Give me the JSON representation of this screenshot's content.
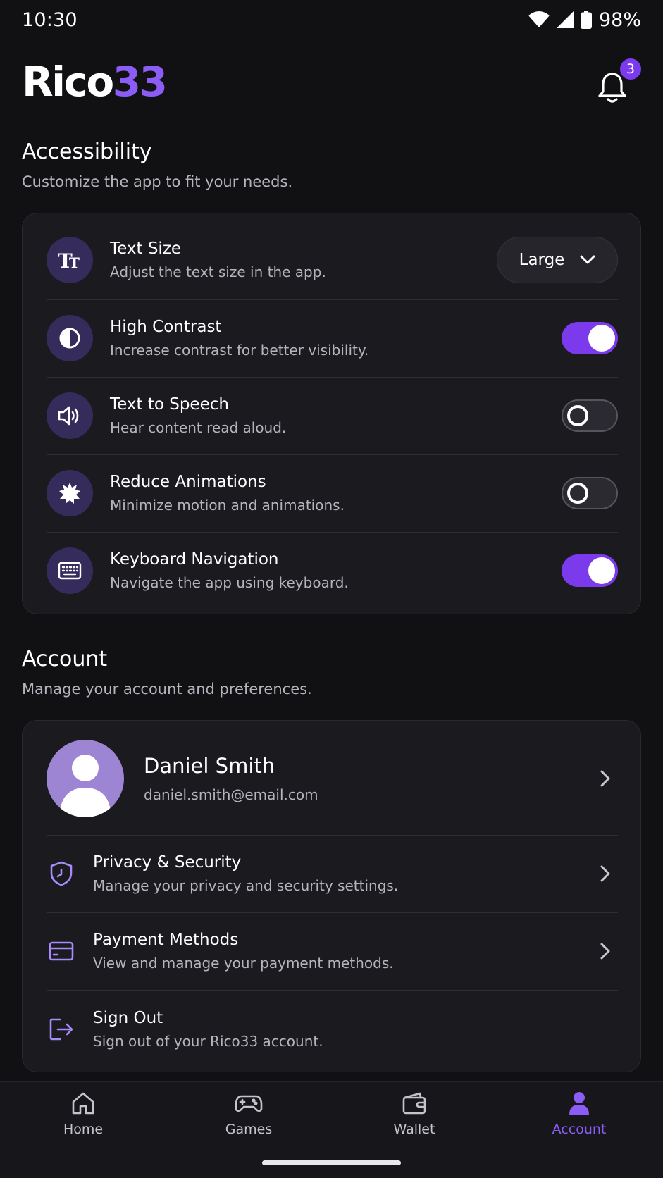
{
  "status_bar": {
    "time": "10:30",
    "battery": "98%"
  },
  "header": {
    "logo_part1": "Rico",
    "logo_part2": "33",
    "notification_count": "3"
  },
  "accessibility": {
    "title": "Accessibility",
    "subtitle": "Customize the app to fit your needs.",
    "items": [
      {
        "title": "Text Size",
        "desc": "Adjust the text size in the app.",
        "control": "dropdown",
        "value": "Large",
        "icon": "text-size-icon"
      },
      {
        "title": "High Contrast",
        "desc": "Increase contrast for better visibility.",
        "control": "toggle",
        "enabled": true,
        "icon": "contrast-icon"
      },
      {
        "title": "Text to Speech",
        "desc": "Hear content read aloud.",
        "control": "toggle",
        "enabled": false,
        "icon": "speaker-icon"
      },
      {
        "title": "Reduce Animations",
        "desc": "Minimize motion and animations.",
        "control": "toggle",
        "enabled": false,
        "icon": "burst-icon"
      },
      {
        "title": "Keyboard Navigation",
        "desc": "Navigate the app using keyboard.",
        "control": "toggle",
        "enabled": true,
        "icon": "keyboard-icon"
      }
    ]
  },
  "account": {
    "title": "Account",
    "subtitle": "Manage your account and preferences.",
    "profile": {
      "name": "Daniel Smith",
      "email": "daniel.smith@email.com"
    },
    "items": [
      {
        "title": "Privacy & Security",
        "desc": "Manage your privacy and security settings.",
        "icon": "shield-icon"
      },
      {
        "title": "Payment Methods",
        "desc": "View and manage your payment methods.",
        "icon": "credit-card-icon"
      },
      {
        "title": "Sign Out",
        "desc": "Sign out of your Rico33 account.",
        "icon": "sign-out-icon"
      }
    ]
  },
  "bottom_nav": {
    "items": [
      {
        "label": "Home",
        "icon": "home-icon",
        "active": false
      },
      {
        "label": "Games",
        "icon": "gamepad-icon",
        "active": false
      },
      {
        "label": "Wallet",
        "icon": "wallet-icon",
        "active": false
      },
      {
        "label": "Account",
        "icon": "person-icon",
        "active": true
      }
    ]
  },
  "colors": {
    "accent": "#7c3aed",
    "background": "#111114",
    "card": "#1a1a1f"
  }
}
